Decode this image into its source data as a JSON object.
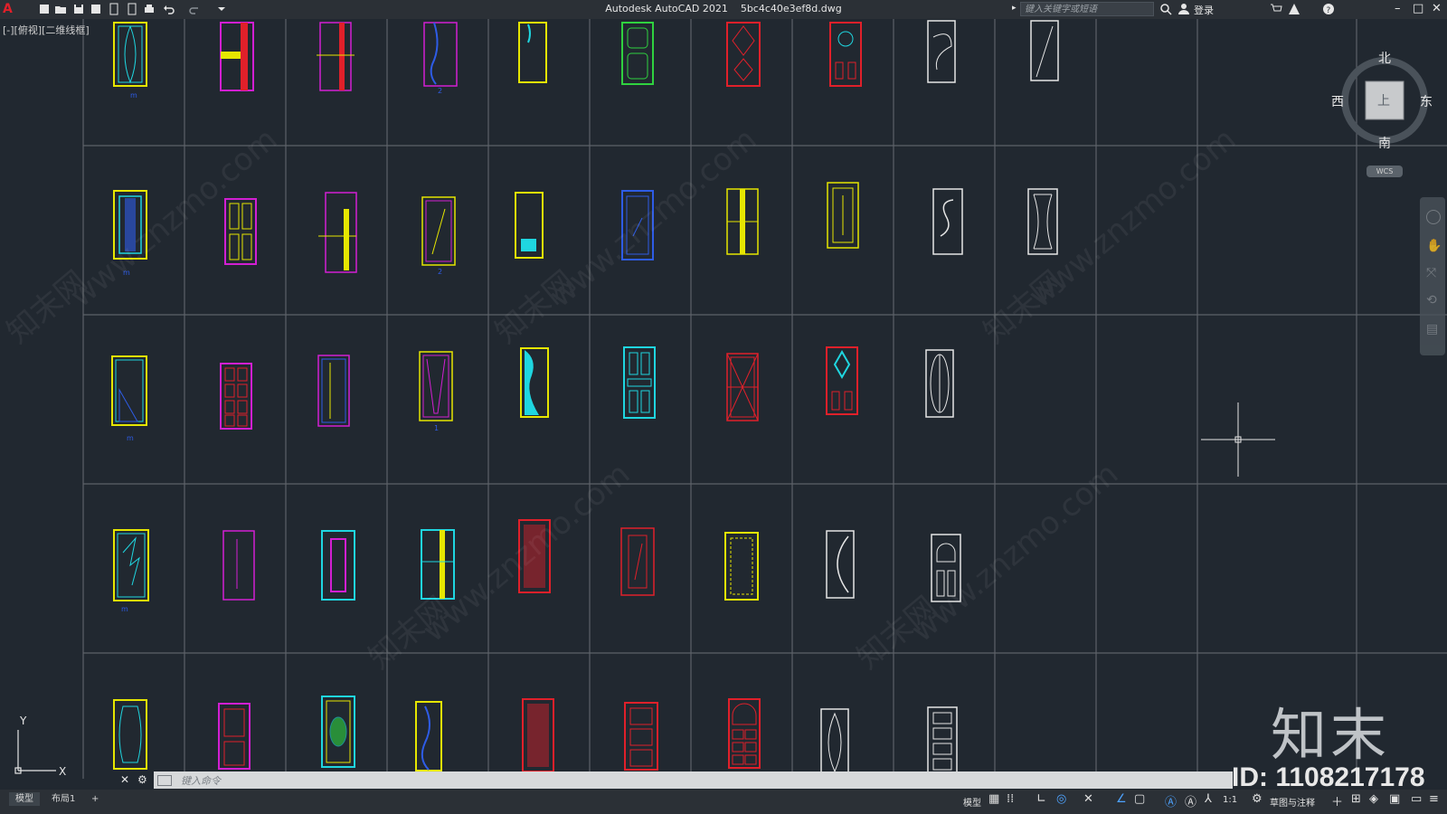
{
  "app": {
    "title": "Autodesk AutoCAD 2021",
    "file": "5bc4c40e3ef8d.dwg",
    "search_placeholder": "键入关键字或短语",
    "login": "登录",
    "app_logo": "A"
  },
  "viewport": {
    "label": "[-][俯视][二维线框]"
  },
  "viewcube": {
    "north": "北",
    "south": "南",
    "west": "西",
    "east": "东",
    "top": "上",
    "wcs": "WCS"
  },
  "ucs": {
    "x": "X",
    "y": "Y"
  },
  "command": {
    "placeholder": "键入命令"
  },
  "layout_tabs": [
    "模型",
    "布局1",
    "+"
  ],
  "status": {
    "model": "模型",
    "scale": "1:1",
    "workspace": "草图与注释"
  },
  "watermarks": {
    "text_cn": "知末网",
    "url": "www.znzmo.com",
    "brand": "知末",
    "id": "ID: 1108217178"
  },
  "drawing_labels": {
    "r1c1": "m",
    "r1c4": "2",
    "r2c1": "m",
    "r2c4": "2",
    "r3c1": "m",
    "r3c4": "1",
    "r4c1": "m"
  },
  "colors": {
    "background": "#212830",
    "grid": "#5d6268",
    "yellow": "#e6e600",
    "magenta": "#d21fd2",
    "red": "#e0202a",
    "cyan": "#1fd6e0",
    "blue": "#2e5ce6",
    "green": "#2fd23f",
    "white": "#e6e6e6"
  }
}
